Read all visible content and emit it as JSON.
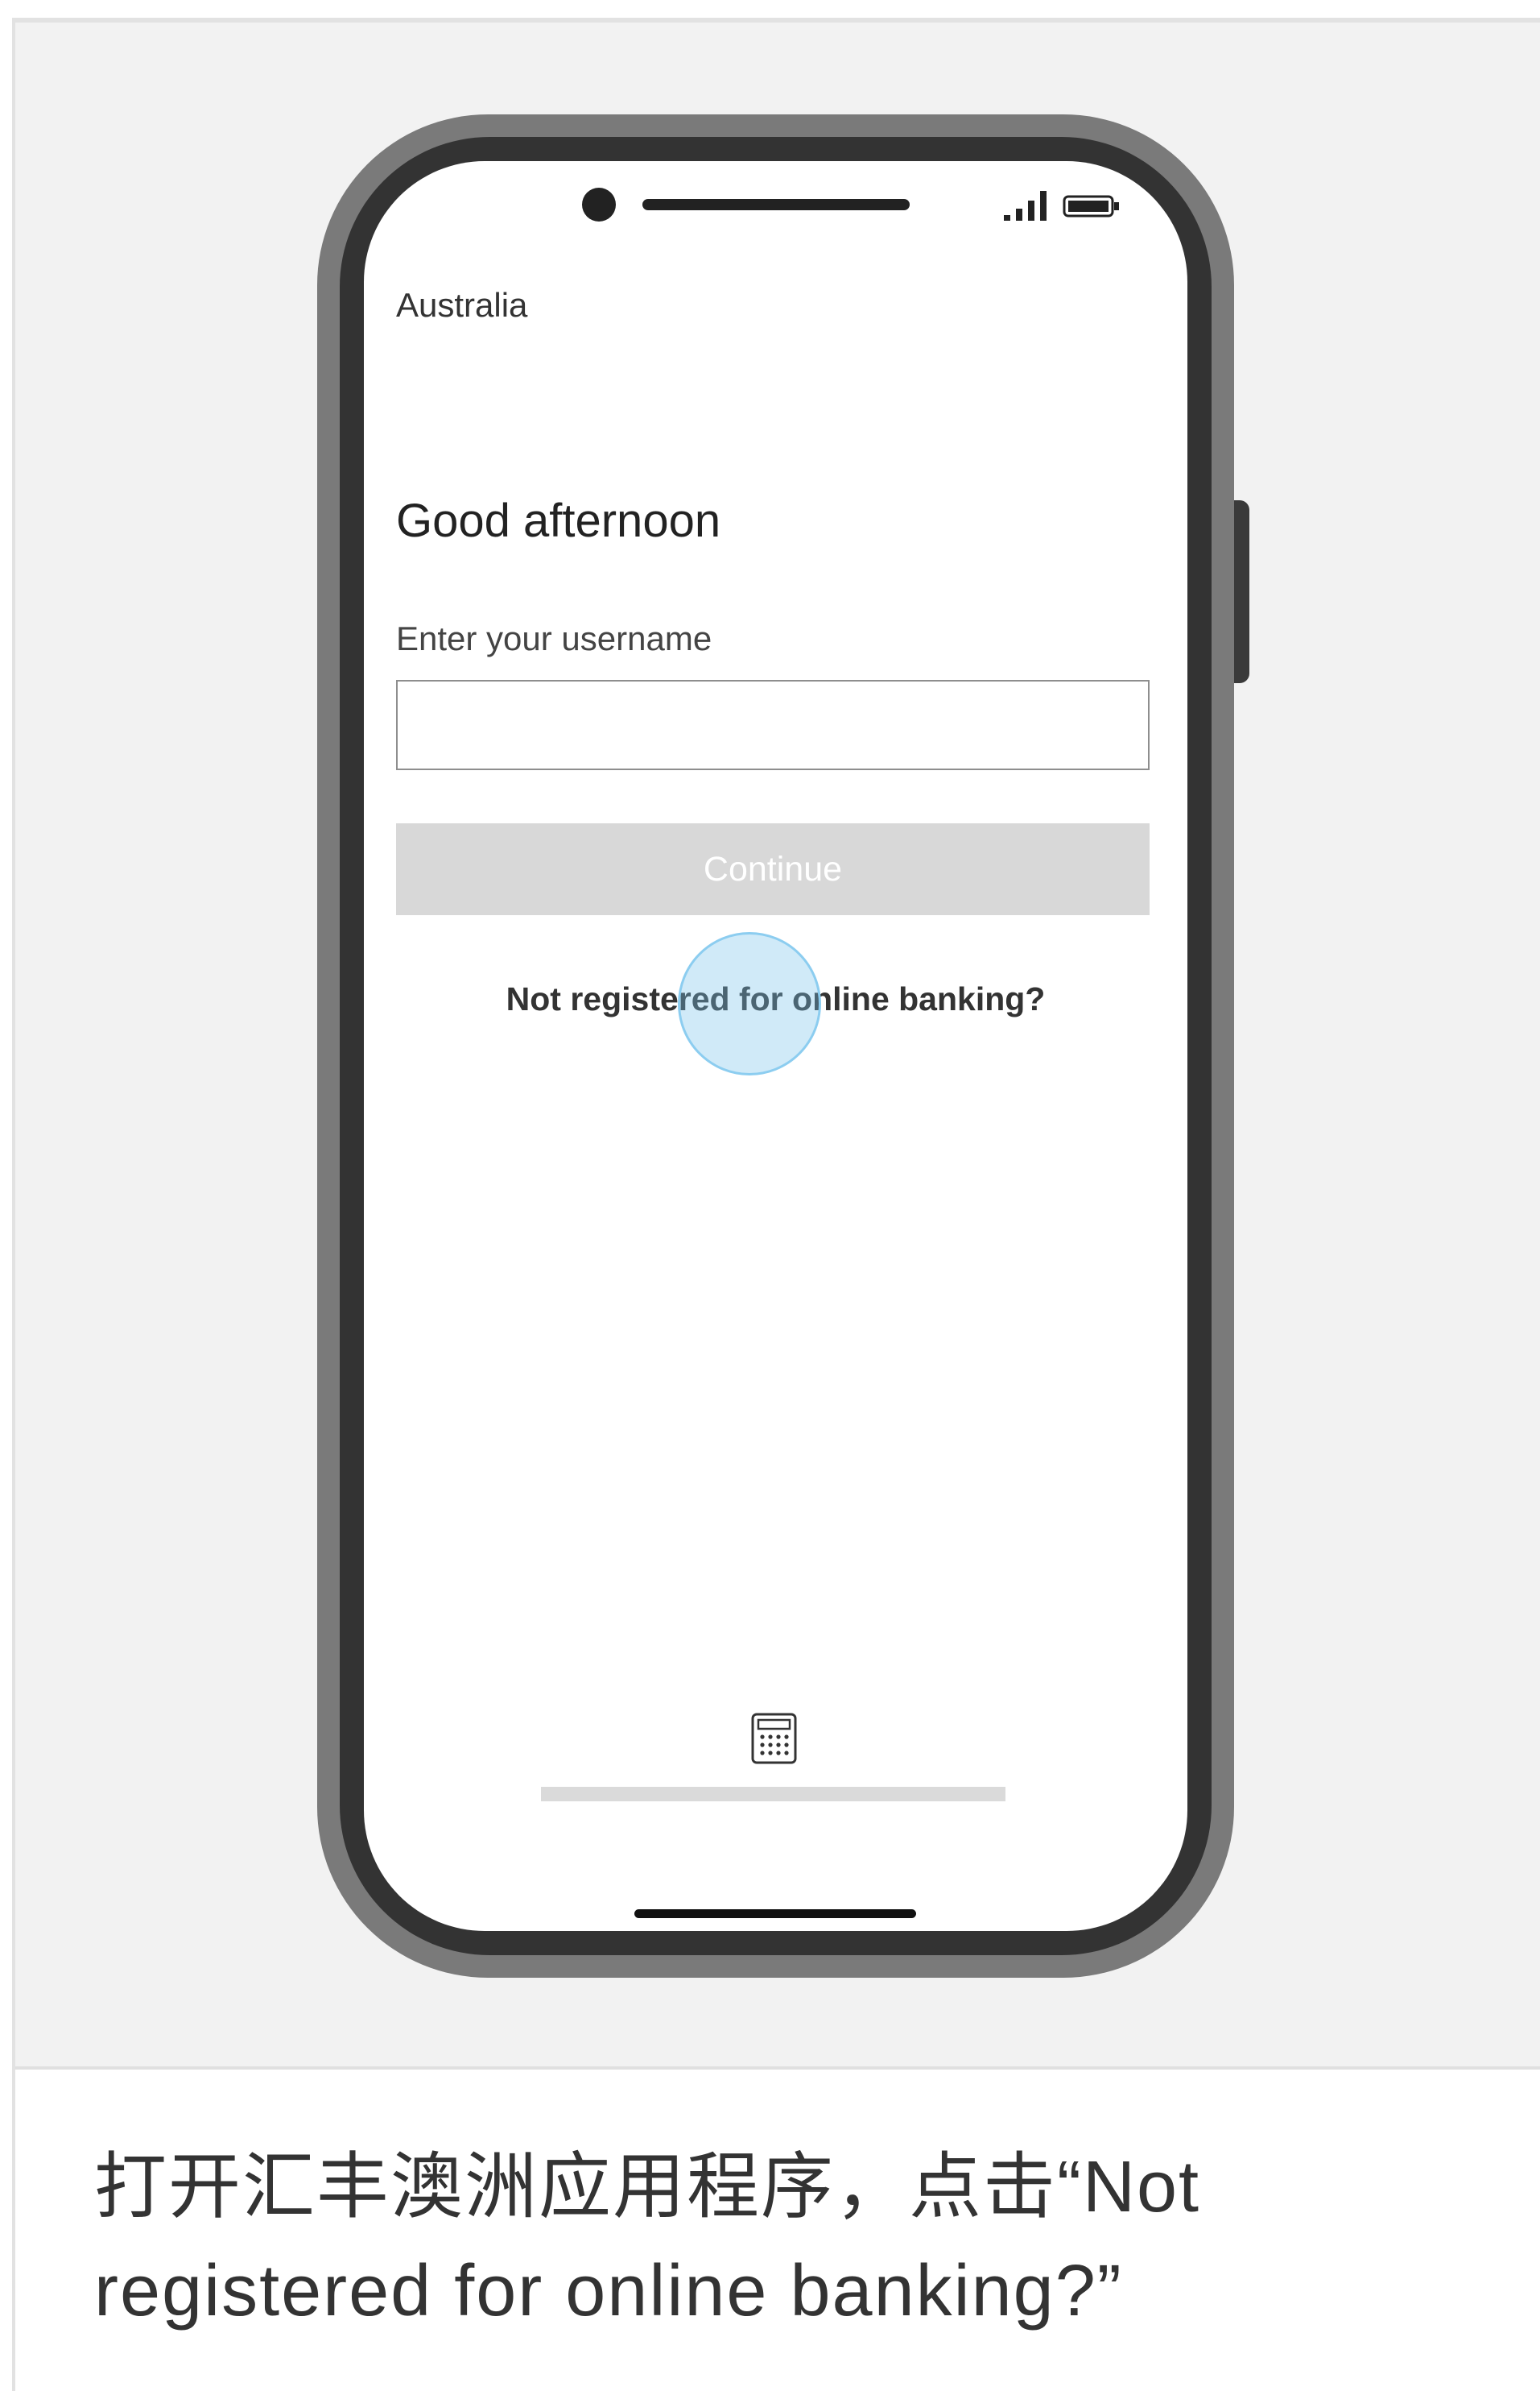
{
  "caption": "打开汇丰澳洲应用程序，点击“Not registered for online banking?”",
  "phone": {
    "status_bar": {
      "icons": [
        "camera-icon",
        "signal-icon",
        "battery-icon"
      ]
    },
    "region": "Australia",
    "greeting": "Good afternoon",
    "username": {
      "label": "Enter your username",
      "value": ""
    },
    "continue_label": "Continue",
    "register_link": "Not registered for online banking?",
    "bottom_icon": "calculator-icon"
  },
  "colors": {
    "panel_bg": "#f2f2f2",
    "phone_rim": "#7a7a7a",
    "phone_bezel": "#333333",
    "continue_disabled": "#d8d8d8",
    "tap_indicator": "#8ccdf0",
    "text": "#333333"
  }
}
